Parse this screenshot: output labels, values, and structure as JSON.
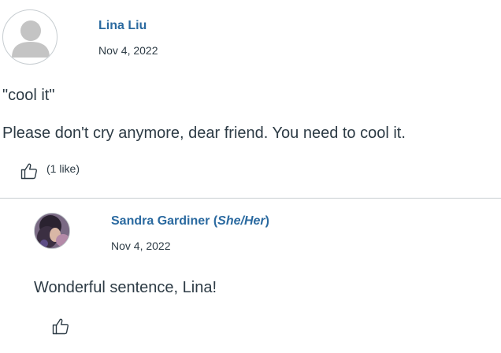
{
  "post": {
    "author": "Lina Liu",
    "date": "Nov 4, 2022",
    "title": "\"cool it\"",
    "body": "Please don't cry anymore, dear friend. You need to cool it.",
    "like_count": "(1 like)",
    "avatar_icon": "default-user-avatar",
    "like_icon": "thumbs-up-icon"
  },
  "reply": {
    "author_name": "Sandra Gardiner",
    "pronouns_open": " (",
    "pronouns": "She/Her",
    "pronouns_close": ")",
    "date": "Nov 4, 2022",
    "body": "Wonderful sentence, Lina!",
    "avatar_icon": "user-photo-avatar",
    "like_icon": "thumbs-up-icon"
  },
  "colors": {
    "link": "#2b6aa0",
    "text": "#2d3b45",
    "divider": "#c7cdd1"
  }
}
